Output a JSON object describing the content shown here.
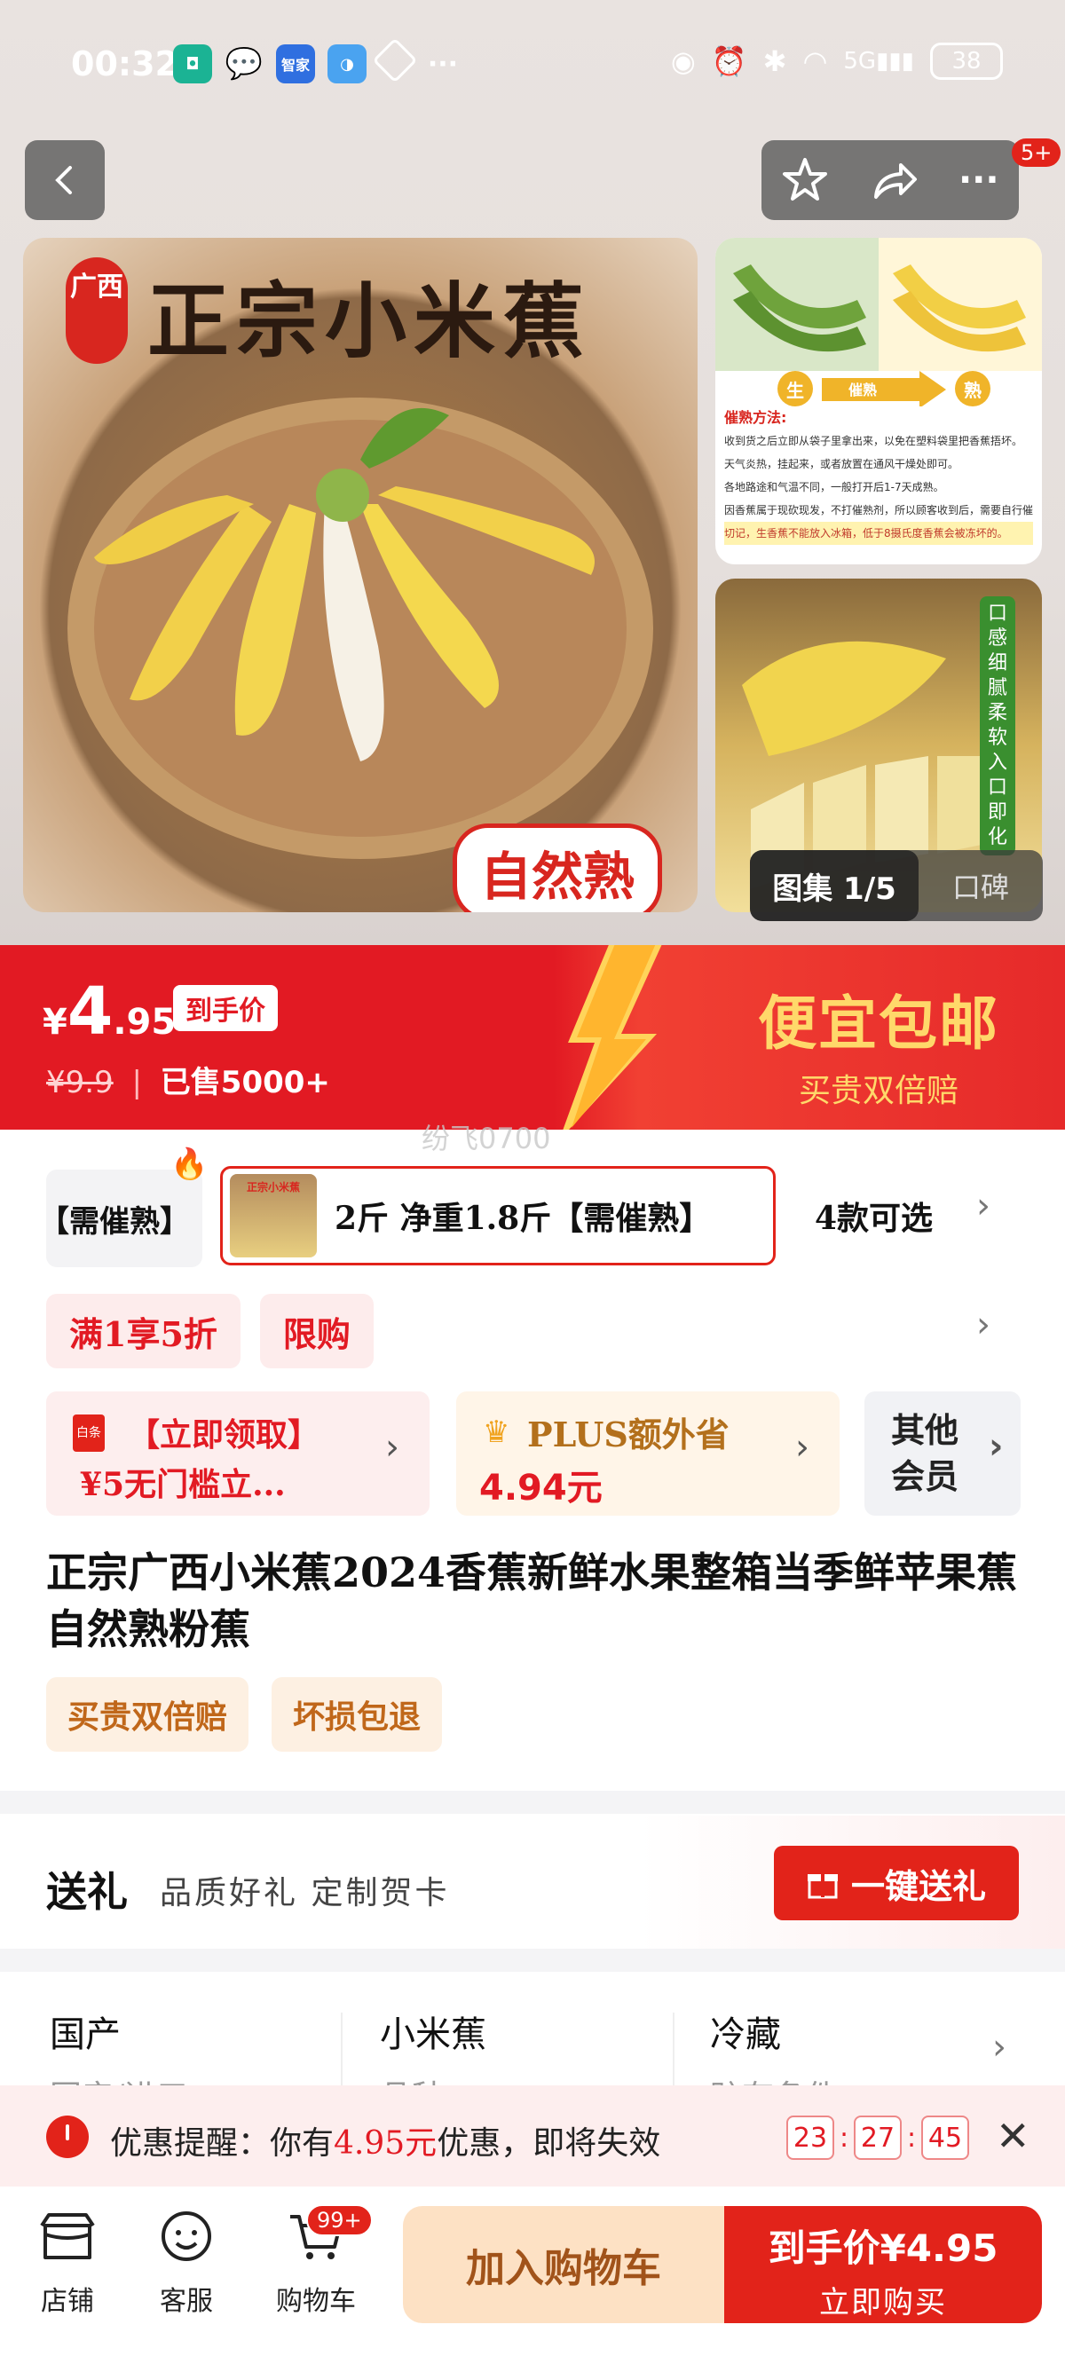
{
  "status_bar": {
    "time": "00:32",
    "app_zhijia": "智家",
    "battery": "38"
  },
  "header": {
    "notification_badge": "5+"
  },
  "hero": {
    "main_title": "正宗小米蕉",
    "seal_text": "广西",
    "natural_label": "自然熟",
    "thumb1_heading": "催熟方法:",
    "thumb1_stage_raw": "生",
    "thumb1_stage_arrow": "催熟",
    "thumb1_stage_ripe": "熟",
    "thumb1_lines": [
      "收到货之后立即从袋子里拿出来，以免在塑料袋里把香蕉捂坏。",
      "天气炎热，挂起来，或者放置在通风干燥处即可。",
      "各地路途和气温不同，一般打开后1-7天成熟。",
      "因香蕉属于现砍现发，不打催熟剂，所以顾客收到后，需要自行催熟。",
      "切记，生香蕉不能放入冰箱，低于8摄氏度香蕉会被冻坏的。"
    ],
    "thumb2_tag": "口感细腻柔软入口即化",
    "gallery_count": "图集 1/5",
    "gallery_review": "口碑"
  },
  "price": {
    "currency": "¥",
    "int": "4",
    "dec": ".95",
    "to_hand_label": "到手价",
    "original": "¥9.9",
    "sold": "已售5000+",
    "promo_big": "便宜包邮",
    "promo_small": "买贵双倍赔"
  },
  "watermark": "纷飞0700",
  "variants": {
    "prev_label": "【需催熟】",
    "selected_thumb_text": "正宗小米蕉",
    "selected_label": "2斤 净重1.8斤【需催熟】",
    "count_label": "4款可选"
  },
  "promo_tags": [
    "满1享5折",
    "限购"
  ],
  "coupons": {
    "c1_icon": "白条",
    "c1_line1": "【立即领取】",
    "c1_line2": "¥5无门槛立...",
    "c2_line1": "PLUS额外省",
    "c2_line2": "4.94元",
    "c3_line1": "其他",
    "c3_line2": "会员"
  },
  "product_title": "正宗广西小米蕉2024香蕉新鲜水果整箱当季鲜苹果蕉自然熟粉蕉",
  "service_badges": [
    "买贵双倍赔",
    "坏损包退"
  ],
  "gift": {
    "title": "送礼",
    "subtitle": "品质好礼 定制贺卡",
    "button": "一键送礼"
  },
  "specs": [
    {
      "value": "国产",
      "label": "国产/进口"
    },
    {
      "value": "小米蕉",
      "label": "品种"
    },
    {
      "value": "冷藏",
      "label": "贮存条件"
    }
  ],
  "reminder": {
    "prefix": "优惠提醒：你有",
    "amount": "4.95元",
    "suffix": "优惠，即将失效",
    "h": "23",
    "m": "27",
    "s": "45"
  },
  "bottom_bar": {
    "shop": "店铺",
    "service": "客服",
    "cart": "购物车",
    "cart_badge": "99+",
    "add_cart": "加入购物车",
    "buy_line1": "到手价¥4.95",
    "buy_line2": "立即购买"
  },
  "colors": {
    "brand_red": "#e2231a",
    "gold": "#ffd86a"
  }
}
